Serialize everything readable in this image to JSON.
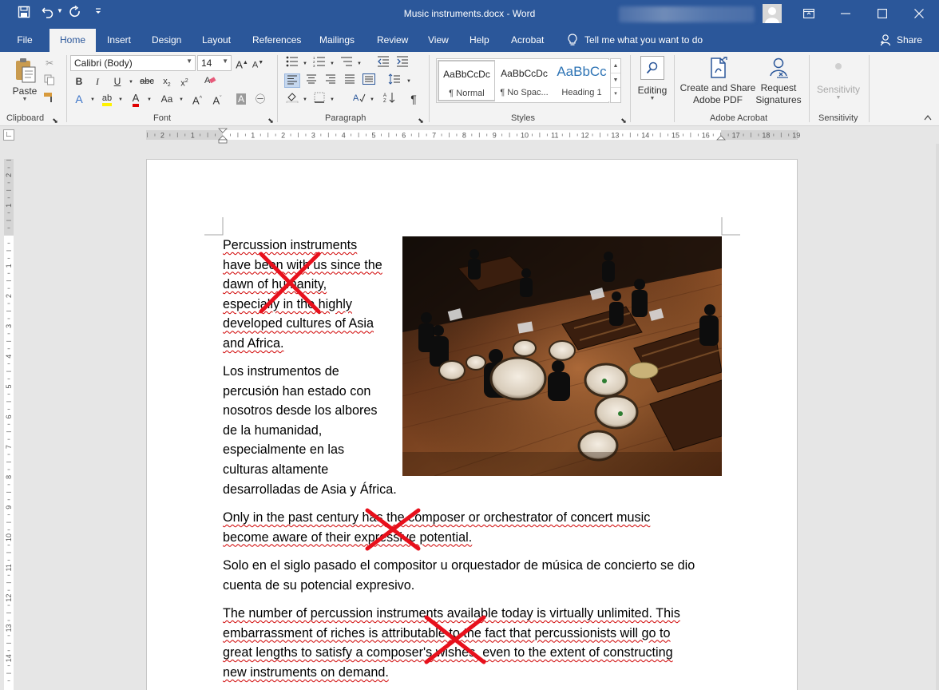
{
  "window": {
    "title": "Music instruments.docx  -  Word"
  },
  "tabs": [
    "File",
    "Home",
    "Insert",
    "Design",
    "Layout",
    "References",
    "Mailings",
    "Review",
    "View",
    "Help",
    "Acrobat"
  ],
  "tell_me": "Tell me what you want to do",
  "share": "Share",
  "ribbon": {
    "clipboard": {
      "paste": "Paste",
      "label": "Clipboard"
    },
    "font": {
      "name": "Calibri (Body)",
      "size": "14",
      "label": "Font"
    },
    "paragraph": {
      "label": "Paragraph"
    },
    "styles": {
      "label": "Styles",
      "items": [
        {
          "sample": "AaBbCcDc",
          "name": "¶ Normal"
        },
        {
          "sample": "AaBbCcDc",
          "name": "¶ No Spac..."
        },
        {
          "sample": "AaBbCc",
          "name": "Heading 1"
        }
      ]
    },
    "editing": {
      "label": "Editing"
    },
    "acrobat": {
      "create": "Create and Share",
      "create2": "Adobe PDF",
      "request": "Request",
      "request2": "Signatures",
      "label": "Adobe Acrobat"
    },
    "sensitivity": {
      "button": "Sensitivity",
      "label": "Sensitivity"
    }
  },
  "ruler": {
    "h_ticks": [
      "2",
      "1",
      "1",
      "2",
      "3",
      "4",
      "5",
      "6",
      "7",
      "8",
      "9",
      "10",
      "11",
      "12",
      "13",
      "14",
      "15",
      "16",
      "17",
      "18",
      "19"
    ],
    "v_ticks": [
      "2",
      "1",
      "1",
      "2",
      "3",
      "4",
      "5",
      "6",
      "7",
      "8",
      "9",
      "10",
      "11",
      "12",
      "13",
      "14"
    ]
  },
  "document": {
    "p1": [
      "Percussion instruments",
      "have been with us since the",
      "dawn of humanity,",
      "especially in the highly",
      "developed cultures of Asia",
      "and Africa."
    ],
    "p2": [
      "Los instrumentos de",
      "percusión han estado con",
      "nosotros desde los albores",
      "de la humanidad,",
      "especialmente en las",
      "culturas altamente",
      "desarrolladas de Asia y África."
    ],
    "p3": [
      "Only in the past century has the composer or orchestrator of concert music",
      "become aware of their expressive potential."
    ],
    "p4": [
      "Solo en el siglo pasado el compositor u orquestador de música de concierto se dio",
      "cuenta de su potencial expresivo."
    ],
    "p5": [
      "The number of percussion instruments available today is virtually unlimited. This",
      "embarrassment of riches is attributable to the fact that percussionists will go to",
      "great lengths to satisfy a composer's wishes, even to the extent of constructing",
      "new instruments on demand."
    ]
  },
  "colors": {
    "accent": "#2b579a",
    "cross": "#e8101c",
    "spell": "#d00000"
  }
}
